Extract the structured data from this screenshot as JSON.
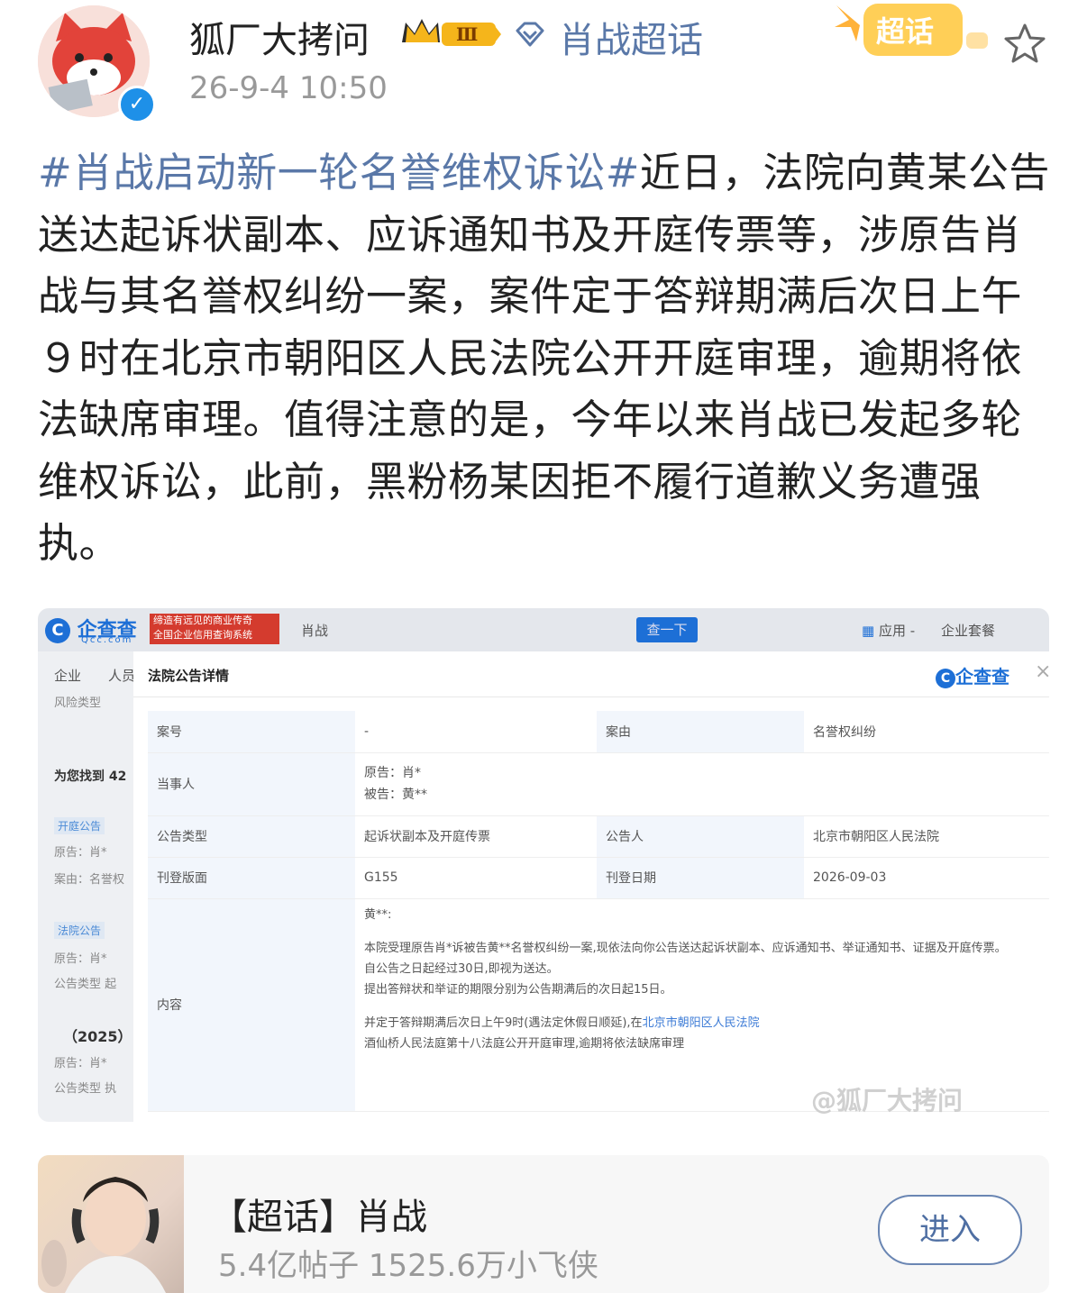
{
  "header": {
    "user_name": "狐厂大拷问",
    "level_badge": "Ⅲ",
    "topic_link": "肖战超话",
    "post_time": "26-9-4 10:50",
    "supertopic_badge": "超话"
  },
  "post": {
    "hashtag": "#肖战启动新一轮名誉维权诉讼#",
    "body": "近日，法院向黄某公告送达起诉状副本、应诉通知书及开庭传票等，涉原告肖战与其名誉权纠纷一案，案件定于答辩期满后次日上午９时在北京市朝阳区人民法院公开开庭审理，逾期将依法缺席审理。值得注意的是，今年以来肖战已发起多轮维权诉讼，此前，黑粉杨某因拒不履行道歉义务遭强执。"
  },
  "screenshot": {
    "logo": "企查查",
    "logo_sub": "Qcc.com",
    "banner": "缔造有远见的商业传奇\n全国企业信用查询系统",
    "search_term": "肖战",
    "search_button": "查一下",
    "app_menu": "应用 -",
    "package_menu": "企业套餐",
    "left_panel": {
      "tab_company": "企业",
      "tab_person": "人员",
      "risk_type": "风险类型",
      "found": "为您找到 42",
      "item1_tag": "开庭公告",
      "item1_line1": "原告：肖*",
      "item1_line2": "案由：名誉权",
      "item2_tag": "法院公告",
      "item2_line1": "原告：肖*",
      "item2_line2": "公告类型 起",
      "item3_title": "（2025）",
      "item3_line1": "原告：肖*",
      "item3_line2": "公告类型 执"
    },
    "modal": {
      "title": "法院公告详情",
      "logo": "企查查",
      "close": "×",
      "case_no_label": "案号",
      "case_no": "-",
      "cause_label": "案由",
      "cause": "名誉权纠纷",
      "parties_label": "当事人",
      "plaintiff": "原告：肖*",
      "defendant": "被告：黄**",
      "type_label": "公告类型",
      "type": "起诉状副本及开庭传票",
      "announcer_label": "公告人",
      "announcer": "北京市朝阳区人民法院",
      "page_label": "刊登版面",
      "page": "G155",
      "date_label": "刊登日期",
      "date": "2026-09-03",
      "content_label": "内容",
      "content_salutation": "黄**:",
      "content_p1": "本院受理原告肖*诉被告黄**名誉权纠纷一案,现依法向你公告送达起诉状副本、应诉通知书、举证通知书、证据及开庭传票。",
      "content_p2": "自公告之日起经过30日,即视为送达。",
      "content_p3": "提出答辩状和举证的期限分别为公告期满后的次日起15日。",
      "content_p4_pre": "并定于答辩期满后次日上午9时(遇法定休假日顺延),在",
      "content_p4_link": "北京市朝阳区人民法院",
      "content_p5": "酒仙桥人民法庭第十八法庭公开开庭审理,逾期将依法缺席审理"
    },
    "watermark": "@狐厂大拷问"
  },
  "supertopic_card": {
    "title": "【超话】肖战",
    "stats": "5.4亿帖子 1525.6万小飞侠",
    "enter_button": "进入"
  },
  "colors": {
    "link": "#5a78a8",
    "qcc_blue": "#1d6fd6",
    "banner_red": "#d43b2e"
  }
}
